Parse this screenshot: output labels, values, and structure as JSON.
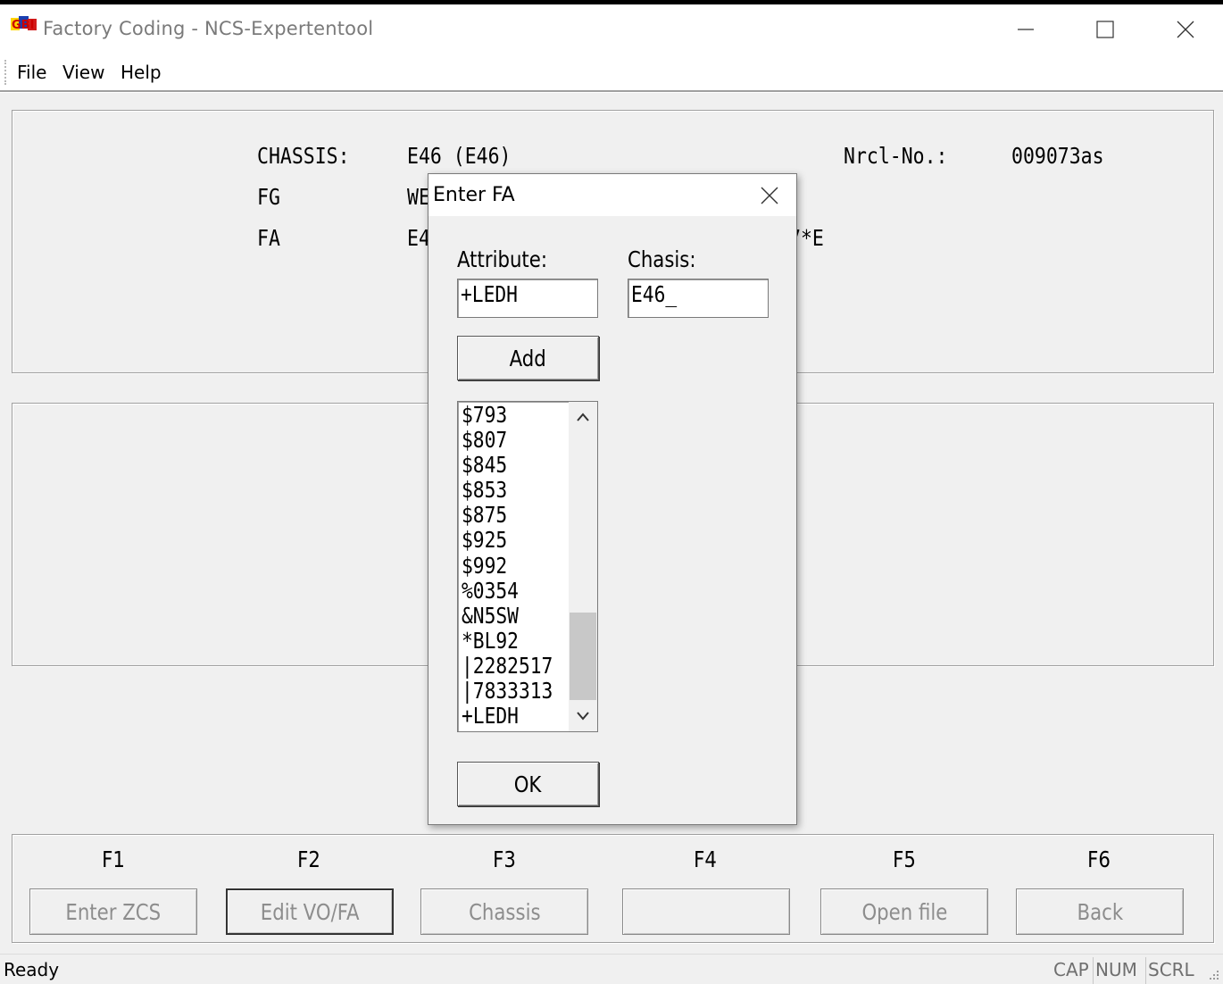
{
  "window": {
    "title": "Factory Coding - NCS-Expertentool",
    "logo_text": "GBI"
  },
  "menu": [
    {
      "label": "File"
    },
    {
      "label": "View"
    },
    {
      "label": "Help"
    }
  ],
  "info": {
    "chassis_label": "CHASSIS:",
    "chassis_value": "E46 (E46)",
    "fg_label": "FG",
    "fg_value_visible": "WE",
    "fa_label": "FA",
    "fa_value_visible": "E4",
    "fa_value_tail_visible": "7*E",
    "nrcl_label": "Nrcl-No.:",
    "nrcl_value": "009073as"
  },
  "function_keys": [
    {
      "key": "F1",
      "label": "Enter ZCS",
      "active": false
    },
    {
      "key": "F2",
      "label": "Edit VO/FA",
      "active": true
    },
    {
      "key": "F3",
      "label": "Chassis",
      "active": false
    },
    {
      "key": "F4",
      "label": "",
      "active": false
    },
    {
      "key": "F5",
      "label": "Open file",
      "active": false
    },
    {
      "key": "F6",
      "label": "Back",
      "active": false
    }
  ],
  "status": {
    "text": "Ready",
    "indicators": [
      "CAP",
      "NUM",
      "SCRL"
    ]
  },
  "dialog": {
    "title": "Enter FA",
    "attribute_label": "Attribute:",
    "attribute_value": "+LEDH",
    "chasis_label": "Chasis:",
    "chasis_value": "E46_",
    "add_button": "Add",
    "ok_button": "OK",
    "list_items": [
      "$793",
      "$807",
      "$845",
      "$853",
      "$875",
      "$925",
      "$992",
      "%0354",
      "&N5SW",
      "*BL92",
      "|2282517",
      "|7833313",
      "+LEDH"
    ]
  }
}
